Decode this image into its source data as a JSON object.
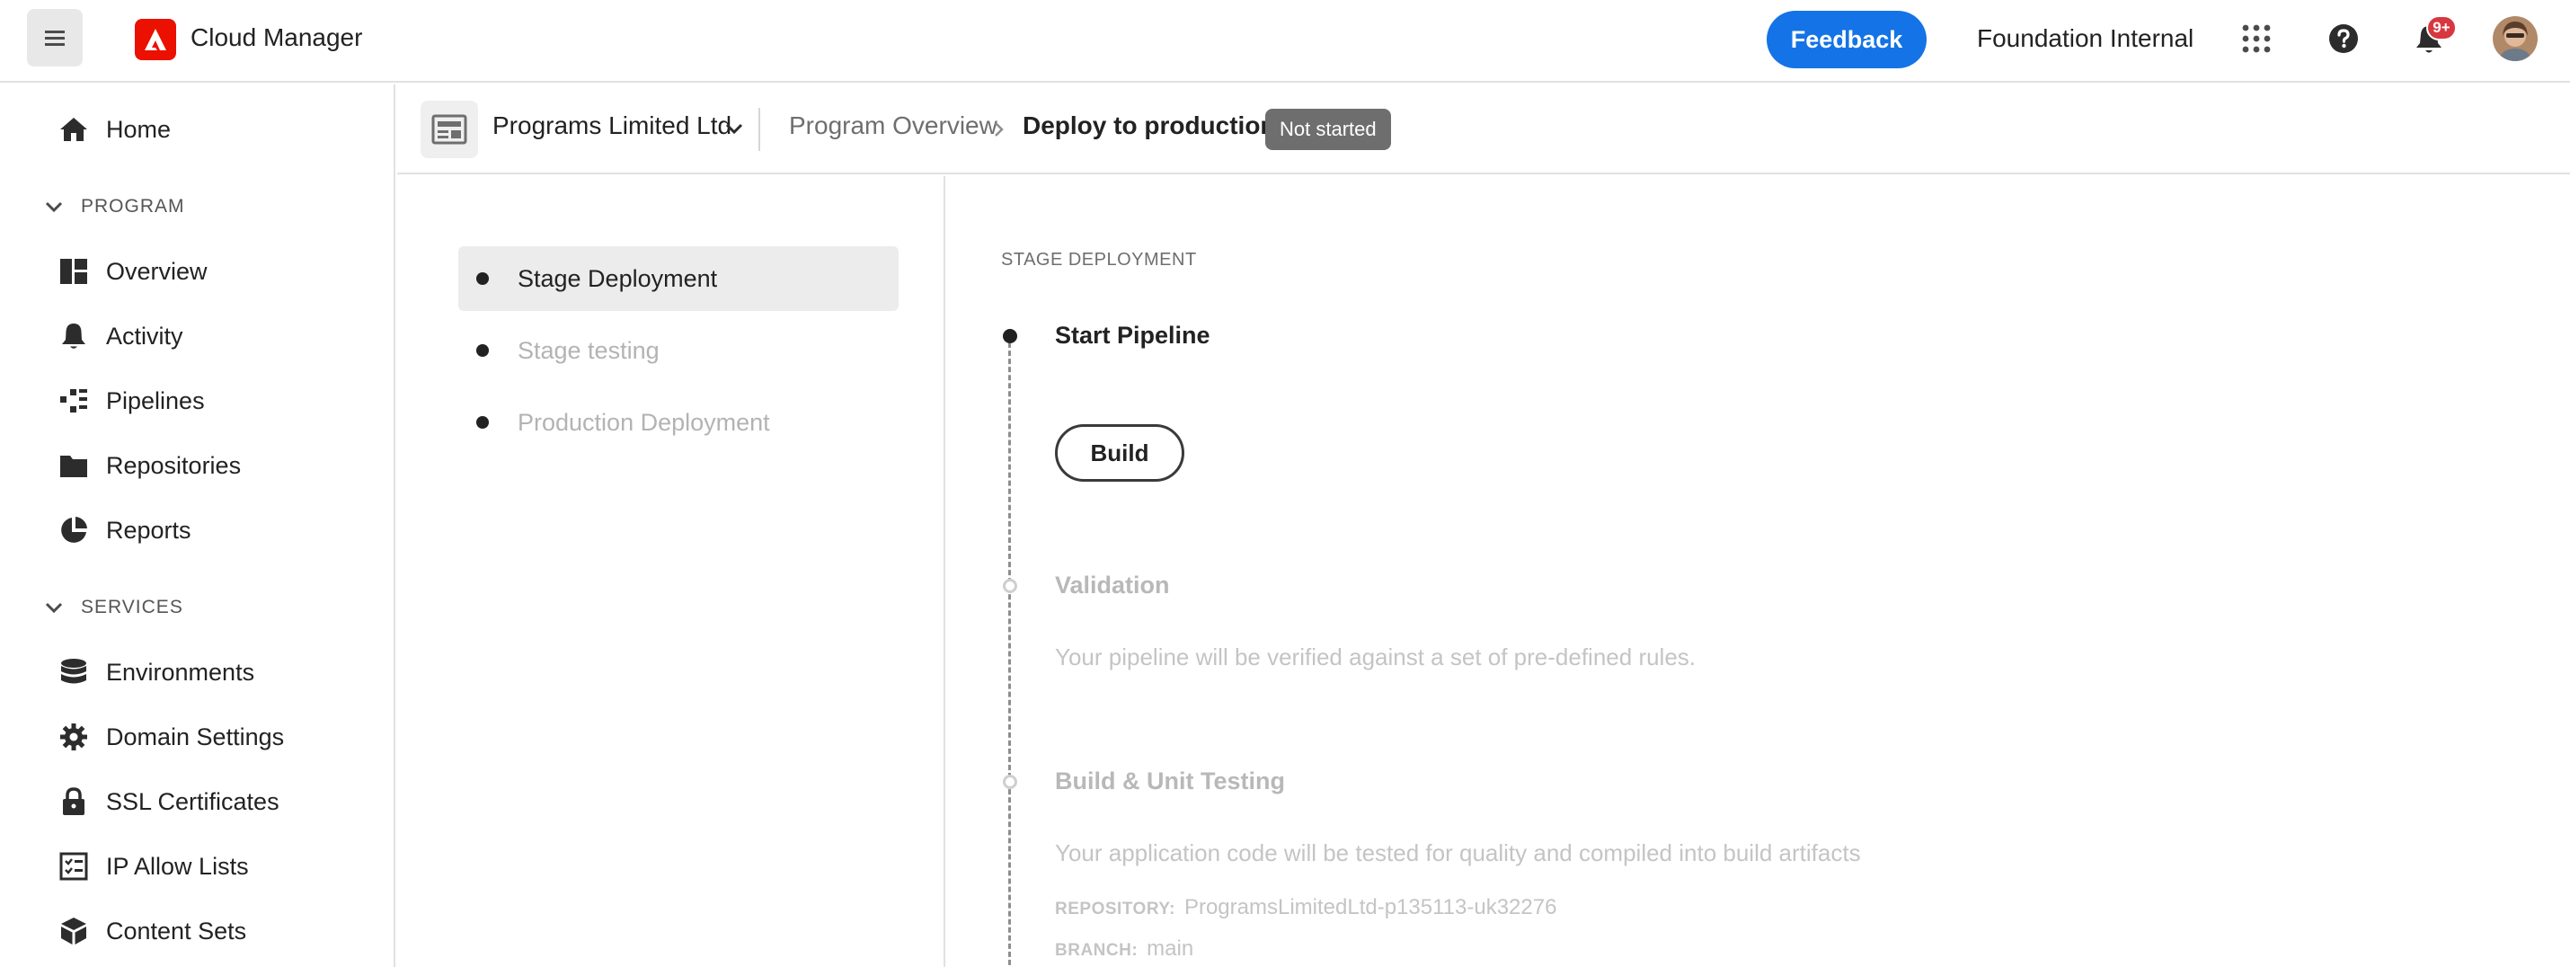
{
  "app": {
    "title": "Cloud Manager",
    "feedback_label": "Feedback",
    "org_name": "Foundation Internal",
    "notification_count": "9+",
    "accent_color": "#1473e6",
    "brand_color": "#eb1000"
  },
  "sidebar": {
    "home": "Home",
    "sections": [
      {
        "title": "PROGRAM",
        "items": [
          {
            "label": "Overview",
            "icon": "overview-icon"
          },
          {
            "label": "Activity",
            "icon": "bell-icon"
          },
          {
            "label": "Pipelines",
            "icon": "pipelines-icon"
          },
          {
            "label": "Repositories",
            "icon": "folder-icon"
          },
          {
            "label": "Reports",
            "icon": "pie-chart-icon"
          }
        ]
      },
      {
        "title": "SERVICES",
        "items": [
          {
            "label": "Environments",
            "icon": "database-icon"
          },
          {
            "label": "Domain Settings",
            "icon": "gear-icon"
          },
          {
            "label": "SSL Certificates",
            "icon": "lock-icon"
          },
          {
            "label": "IP Allow Lists",
            "icon": "checklist-icon"
          },
          {
            "label": "Content Sets",
            "icon": "box-icon"
          }
        ]
      }
    ]
  },
  "breadcrumb": {
    "program_name": "Programs Limited Ltd",
    "items": [
      "Program Overview",
      "Deploy to production"
    ],
    "status": "Not started"
  },
  "steps": [
    {
      "label": "Stage Deployment",
      "active": true
    },
    {
      "label": "Stage testing",
      "active": false
    },
    {
      "label": "Production Deployment",
      "active": false
    }
  ],
  "content": {
    "section_title": "STAGE DEPLOYMENT",
    "start_title": "Start Pipeline",
    "build_label": "Build",
    "validation": {
      "title": "Validation",
      "description": "Your pipeline will be verified against a set of pre-defined rules."
    },
    "build_testing": {
      "title": "Build & Unit Testing",
      "description": "Your application code will be tested for quality and compiled into build artifacts",
      "repository_key": "REPOSITORY:",
      "repository_value": "ProgramsLimitedLtd-p135113-uk32276",
      "branch_key": "BRANCH:",
      "branch_value": "main"
    }
  }
}
